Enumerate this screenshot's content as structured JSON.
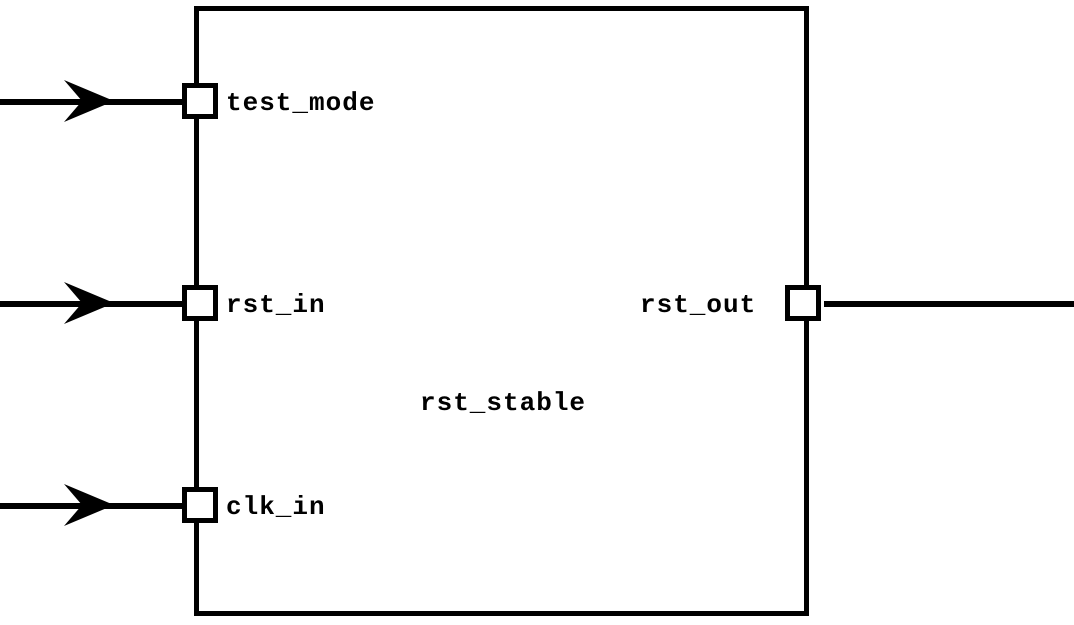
{
  "block": {
    "name": "rst_stable",
    "inputs": [
      {
        "id": "test_mode",
        "label": "test_mode"
      },
      {
        "id": "rst_in",
        "label": "rst_in"
      },
      {
        "id": "clk_in",
        "label": "clk_in"
      }
    ],
    "outputs": [
      {
        "id": "rst_out",
        "label": "rst_out"
      }
    ]
  }
}
